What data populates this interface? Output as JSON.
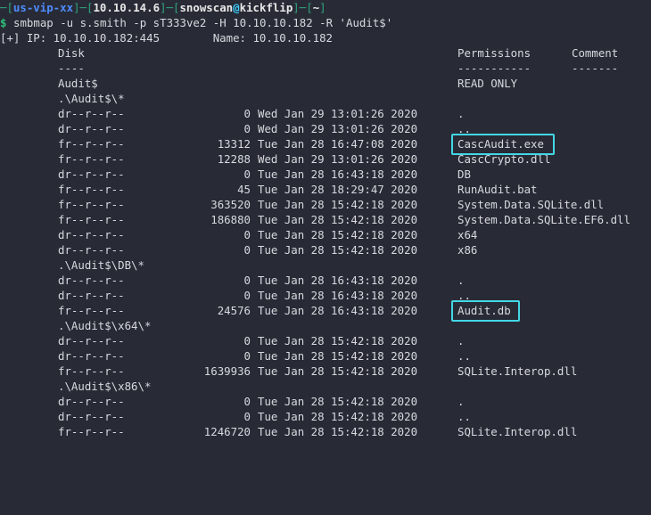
{
  "prompt": {
    "vpn": "us-vip-xx",
    "ip": "10.10.14.6",
    "user": "snowscan",
    "host": "kickflip",
    "cwd": "~",
    "dollar": "$",
    "command": "smbmap -u s.smith -p sT333ve2 -H 10.10.10.182 -R 'Audit$'"
  },
  "header": {
    "info": "[+] IP: 10.10.10.182:445        Name: 10.10.10.182",
    "disk": "Disk",
    "permissions": "Permissions",
    "comment": "Comment",
    "disk_sep": "----",
    "permissions_sep": "-----------",
    "comment_sep": "-------"
  },
  "share": {
    "name": "Audit$",
    "permission": "READ ONLY"
  },
  "sections": [
    {
      "path": ".\\Audit$\\*",
      "entries": [
        {
          "mode": "dr--r--r--",
          "size": "0",
          "date": "Wed Jan 29 13:01:26 2020",
          "name": "."
        },
        {
          "mode": "dr--r--r--",
          "size": "0",
          "date": "Wed Jan 29 13:01:26 2020",
          "name": ".."
        },
        {
          "mode": "fr--r--r--",
          "size": "13312",
          "date": "Tue Jan 28 16:47:08 2020",
          "name": "CascAudit.exe"
        },
        {
          "mode": "fr--r--r--",
          "size": "12288",
          "date": "Wed Jan 29 13:01:26 2020",
          "name": "CascCrypto.dll"
        },
        {
          "mode": "dr--r--r--",
          "size": "0",
          "date": "Tue Jan 28 16:43:18 2020",
          "name": "DB"
        },
        {
          "mode": "fr--r--r--",
          "size": "45",
          "date": "Tue Jan 28 18:29:47 2020",
          "name": "RunAudit.bat"
        },
        {
          "mode": "fr--r--r--",
          "size": "363520",
          "date": "Tue Jan 28 15:42:18 2020",
          "name": "System.Data.SQLite.dll"
        },
        {
          "mode": "fr--r--r--",
          "size": "186880",
          "date": "Tue Jan 28 15:42:18 2020",
          "name": "System.Data.SQLite.EF6.dll"
        },
        {
          "mode": "dr--r--r--",
          "size": "0",
          "date": "Tue Jan 28 15:42:18 2020",
          "name": "x64"
        },
        {
          "mode": "dr--r--r--",
          "size": "0",
          "date": "Tue Jan 28 15:42:18 2020",
          "name": "x86"
        }
      ]
    },
    {
      "path": ".\\Audit$\\DB\\*",
      "entries": [
        {
          "mode": "dr--r--r--",
          "size": "0",
          "date": "Tue Jan 28 16:43:18 2020",
          "name": "."
        },
        {
          "mode": "dr--r--r--",
          "size": "0",
          "date": "Tue Jan 28 16:43:18 2020",
          "name": ".."
        },
        {
          "mode": "fr--r--r--",
          "size": "24576",
          "date": "Tue Jan 28 16:43:18 2020",
          "name": "Audit.db"
        }
      ]
    },
    {
      "path": ".\\Audit$\\x64\\*",
      "entries": [
        {
          "mode": "dr--r--r--",
          "size": "0",
          "date": "Tue Jan 28 15:42:18 2020",
          "name": "."
        },
        {
          "mode": "dr--r--r--",
          "size": "0",
          "date": "Tue Jan 28 15:42:18 2020",
          "name": ".."
        },
        {
          "mode": "fr--r--r--",
          "size": "1639936",
          "date": "Tue Jan 28 15:42:18 2020",
          "name": "SQLite.Interop.dll"
        }
      ]
    },
    {
      "path": ".\\Audit$\\x86\\*",
      "entries": [
        {
          "mode": "dr--r--r--",
          "size": "0",
          "date": "Tue Jan 28 15:42:18 2020",
          "name": "."
        },
        {
          "mode": "dr--r--r--",
          "size": "0",
          "date": "Tue Jan 28 15:42:18 2020",
          "name": ".."
        },
        {
          "mode": "fr--r--r--",
          "size": "1246720",
          "date": "Tue Jan 28 15:42:18 2020",
          "name": "SQLite.Interop.dll"
        }
      ]
    }
  ],
  "highlighted_files": [
    "CascAudit.exe",
    "Audit.db"
  ],
  "colors": {
    "background": "#282b36",
    "text": "#d7d9de",
    "highlight_border": "#44d7e6",
    "prompt_green": "#2fa37a",
    "prompt_blue": "#4f8cff"
  }
}
